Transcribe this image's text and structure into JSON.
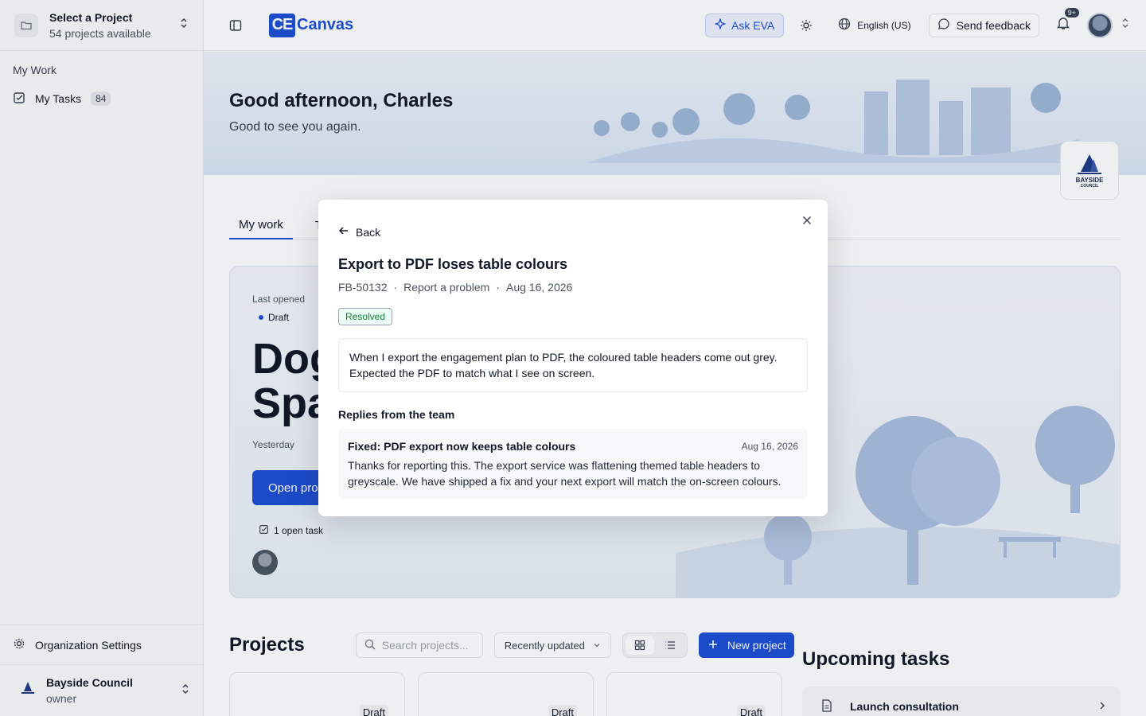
{
  "sidebar": {
    "project_title": "Select a Project",
    "project_sub": "54 projects available",
    "section": "My Work",
    "tasks_label": "My Tasks",
    "tasks_count": "84",
    "org_settings": "Organization Settings",
    "org_name": "Bayside Council",
    "org_role": "owner"
  },
  "topbar": {
    "logo_ce": "CE",
    "logo_text": "Canvas",
    "ask_eva": "Ask EVA",
    "language": "English (US)",
    "feedback": "Send feedback",
    "notif_badge": "9+"
  },
  "hero": {
    "greeting": "Good afternoon, Charles",
    "sub": "Good to see you again.",
    "council_logo_text": "BAYSIDE",
    "council_logo_sub": "COUNCIL"
  },
  "tabs": [
    "My work",
    "Te"
  ],
  "card": {
    "last_opened": "Last opened",
    "status": "Draft",
    "title_line1": "Dog",
    "title_line2": "Spa",
    "time": "Yesterday",
    "open_button": "Open pro",
    "open_tasks": "1 open task"
  },
  "projects": {
    "heading": "Projects",
    "search_placeholder": "Search projects...",
    "sort": "Recently updated",
    "new_button": "New project",
    "card_status": [
      "Draft",
      "Draft",
      "Draft"
    ]
  },
  "upcoming": {
    "heading": "Upcoming tasks",
    "item": "Launch consultation"
  },
  "modal": {
    "back": "Back",
    "title": "Export to PDF loses table colours",
    "id": "FB-50132",
    "type": "Report a problem",
    "date": "Aug 16, 2026",
    "status": "Resolved",
    "description": "When I export the engagement plan to PDF, the coloured table headers come out grey. Expected the PDF to match what I see on screen.",
    "replies_heading": "Replies from the team",
    "reply": {
      "title": "Fixed: PDF export now keeps table colours",
      "date": "Aug 16, 2026",
      "body": "Thanks for reporting this. The export service was flattening themed table headers to greyscale. We have shipped a fix and your next export will match the on-screen colours."
    }
  },
  "colors": {
    "accent": "#1e4fd6",
    "resolved": "#15803d"
  }
}
